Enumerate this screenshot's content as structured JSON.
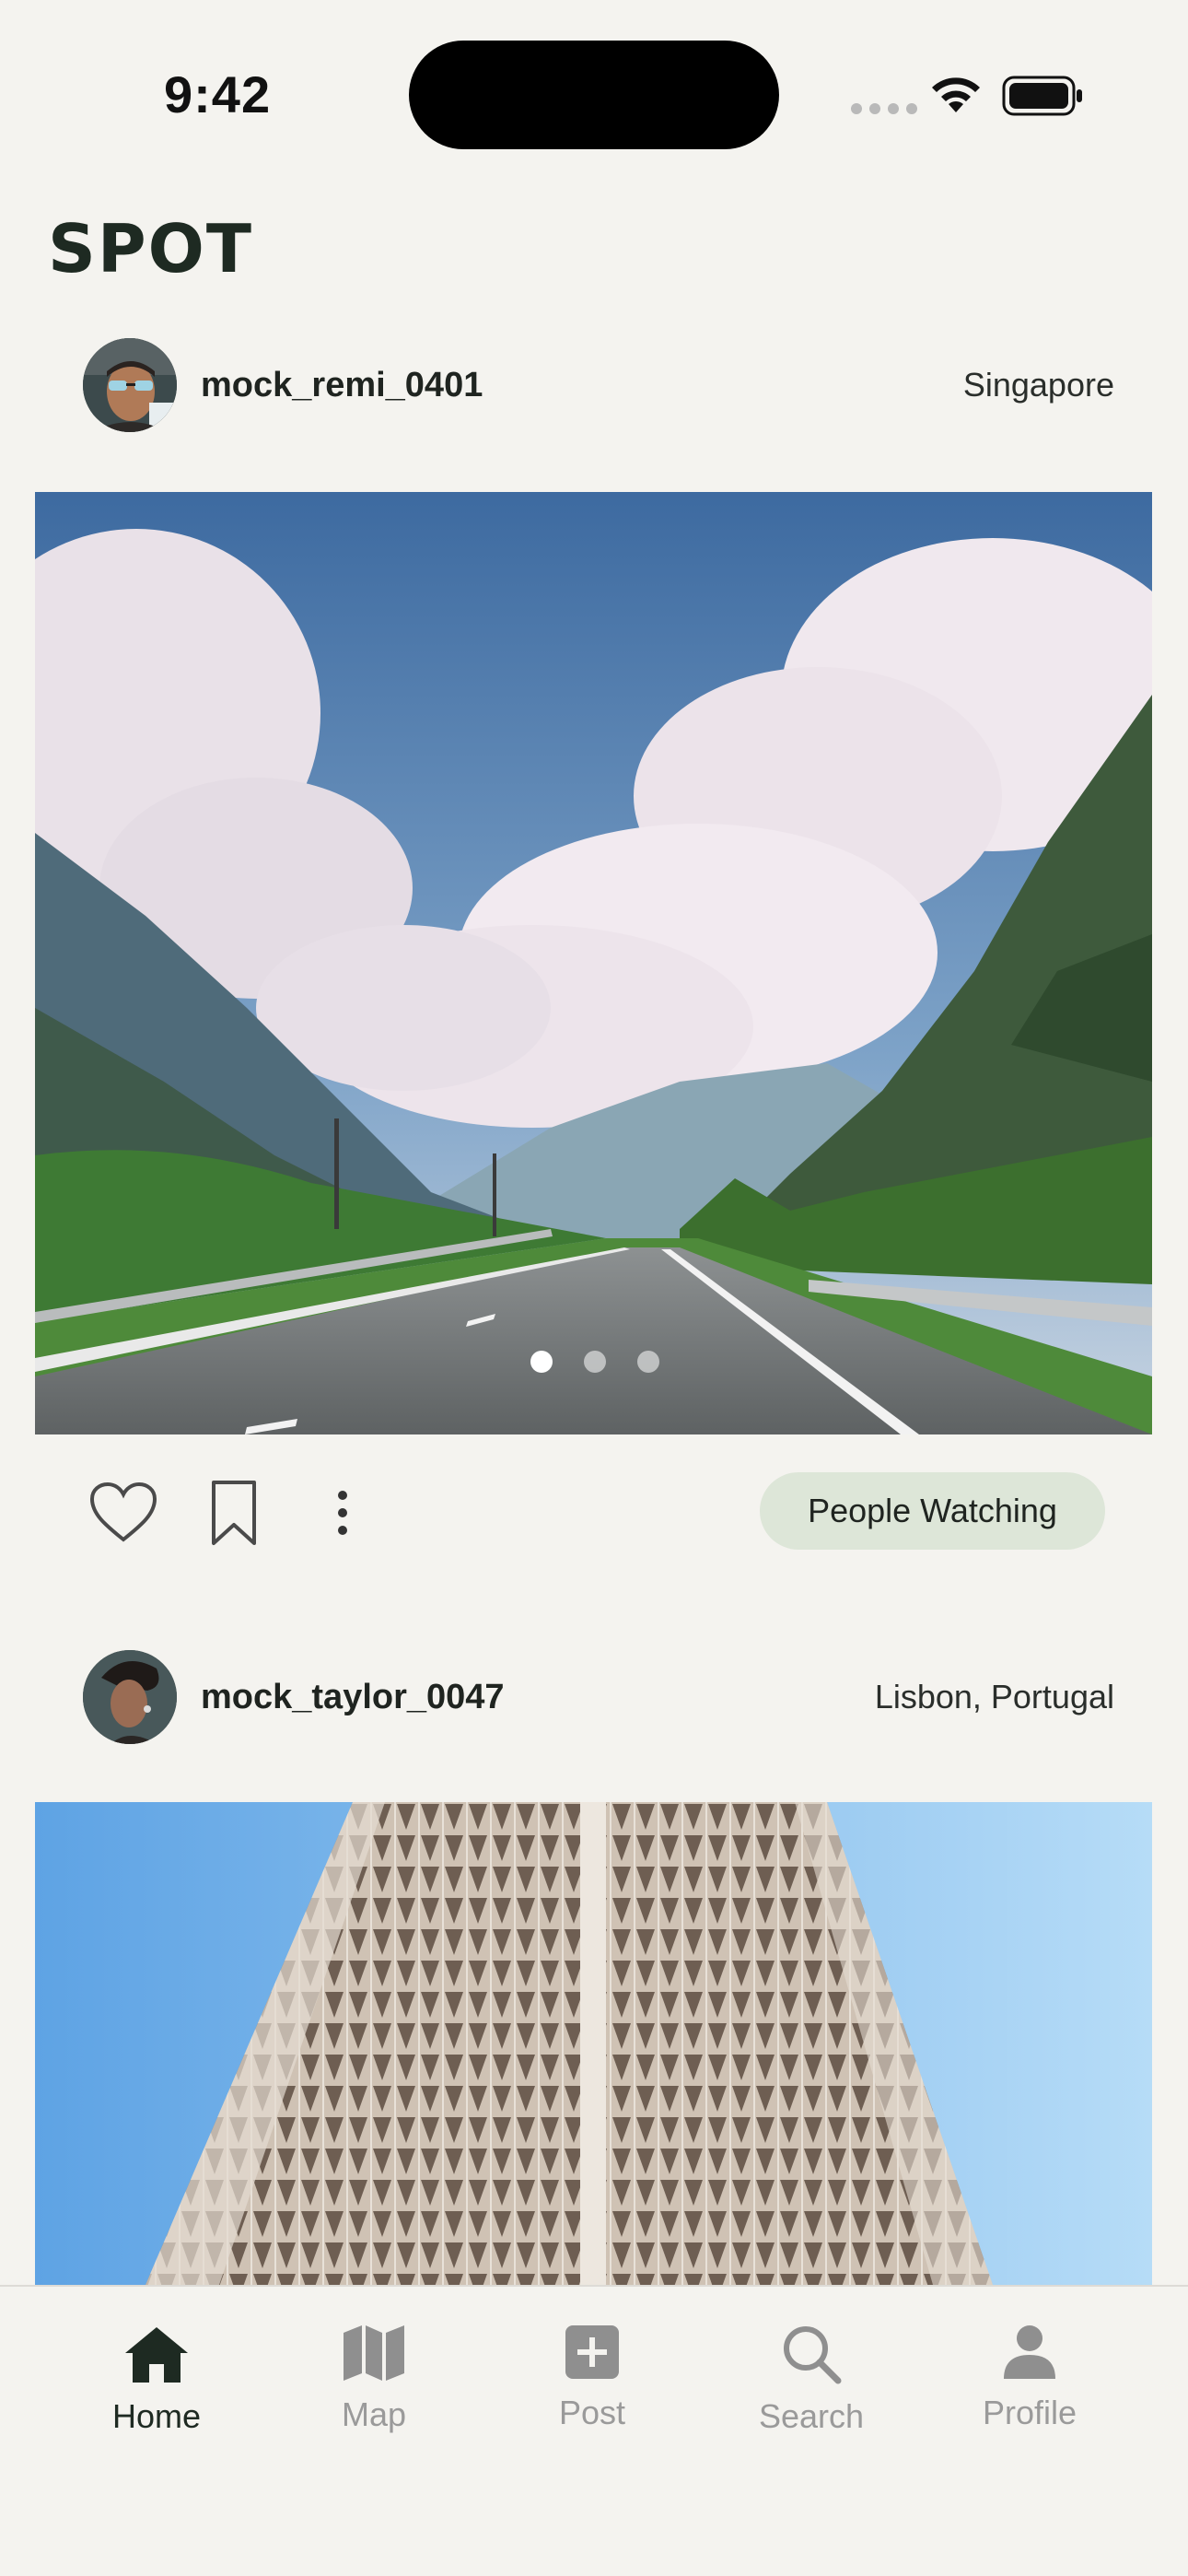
{
  "status": {
    "time": "9:42"
  },
  "app": {
    "title": "SPOT"
  },
  "posts": [
    {
      "username": "mock_remi_0401",
      "location": "Singapore",
      "tag": "People Watching",
      "carousel": {
        "count": 3,
        "active": 1
      }
    },
    {
      "username": "mock_taylor_0047",
      "location": "Lisbon, Portugal"
    }
  ],
  "tabs": [
    {
      "label": "Home",
      "icon": "home-icon",
      "active": true
    },
    {
      "label": "Map",
      "icon": "map-icon",
      "active": false
    },
    {
      "label": "Post",
      "icon": "plus-square-icon",
      "active": false
    },
    {
      "label": "Search",
      "icon": "search-icon",
      "active": false
    },
    {
      "label": "Profile",
      "icon": "person-icon",
      "active": false
    }
  ],
  "colors": {
    "background": "#f4f3ef",
    "accent": "#1e2a22",
    "tag_bg": "#dde6d8",
    "inactive": "#9a9a9a"
  }
}
